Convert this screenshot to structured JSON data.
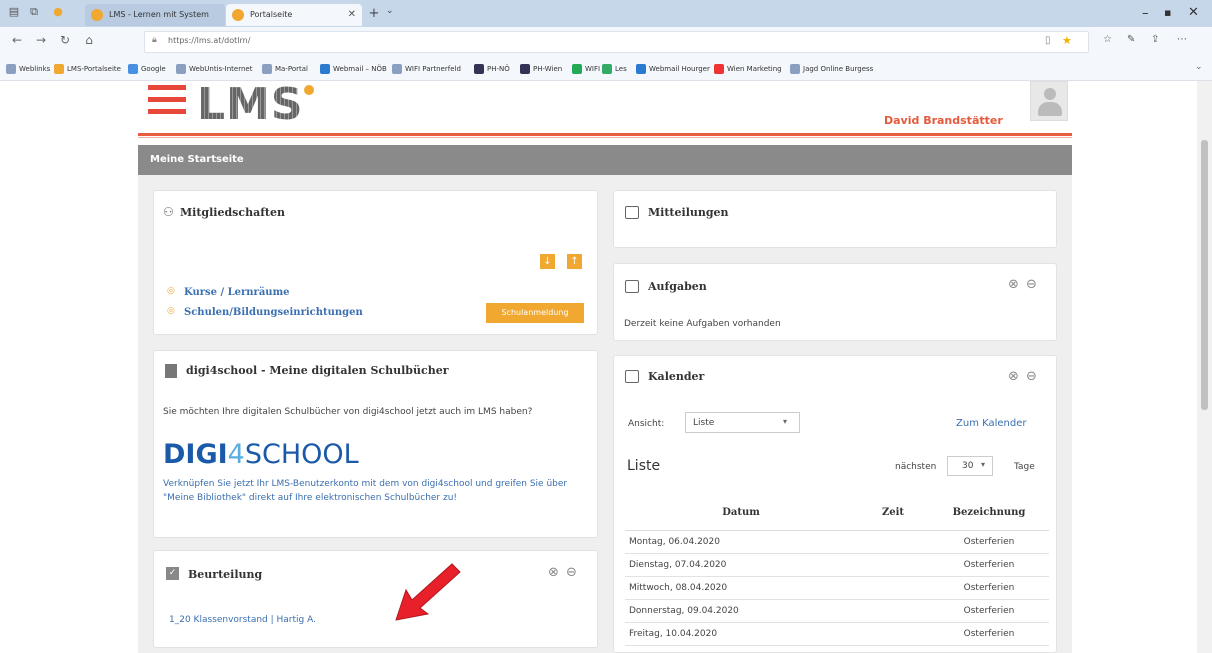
{
  "browser": {
    "tabs": [
      {
        "label": "LMS - Lernen mit System",
        "active": false
      },
      {
        "label": "Portalseite",
        "active": true
      }
    ],
    "url": "https://lms.at/dotlrn/",
    "bookmarks": [
      "Weblinks",
      "LMS-Portalseite",
      "Google",
      "WebUntis-Internet",
      "Ma-Portal",
      "Webmail – NÖB",
      "WIFI Partnerfeld",
      "PH-NÖ",
      "PH-Wien",
      "WIFI",
      "Les",
      "Webmail Hourger",
      "Wien Marketing",
      "Jagd Online Burgess"
    ]
  },
  "header": {
    "logo_text": "LMS",
    "user_name": "David Brandstätter"
  },
  "page": {
    "title": "Meine Startseite"
  },
  "mitglied": {
    "title": "Mitgliedschaften",
    "items": [
      "Kurse / Lernräume",
      "Schulen/Bildungseinrichtungen"
    ],
    "badge": "Schulanmeldung"
  },
  "digi": {
    "title": "digi4school - Meine digitalen Schulbücher",
    "intro": "Sie möchten Ihre digitalen Schulbücher von digi4school jetzt auch im LMS haben?",
    "logo_a": "DIGI",
    "logo_b": "4",
    "logo_c": "SCHOOL",
    "text": "Verknüpfen Sie jetzt Ihr LMS-Benutzerkonto mit dem von digi4school und greifen Sie über \"Meine Bibliothek\" direkt auf Ihre elektronischen Schulbücher zu!"
  },
  "beurteilung": {
    "title": "Beurteilung",
    "link": "1_20 Klassenvorstand | Hartig A."
  },
  "mitteilungen": {
    "title": "Mitteilungen"
  },
  "aufgaben": {
    "title": "Aufgaben",
    "empty": "Derzeit keine Aufgaben vorhanden"
  },
  "kalender": {
    "title": "Kalender",
    "view_label": "Ansicht:",
    "view_value": "Liste",
    "to_calendar": "Zum Kalender",
    "list_heading": "Liste",
    "next_label": "nächsten",
    "next_value": "30",
    "days_label": "Tage",
    "columns": [
      "Datum",
      "Zeit",
      "Bezeichnung"
    ],
    "rows": [
      [
        "Montag, 06.04.2020",
        "",
        "Osterferien"
      ],
      [
        "Dienstag, 07.04.2020",
        "",
        "Osterferien"
      ],
      [
        "Mittwoch, 08.04.2020",
        "",
        "Osterferien"
      ],
      [
        "Donnerstag, 09.04.2020",
        "",
        "Osterferien"
      ],
      [
        "Freitag, 10.04.2020",
        "",
        "Osterferien"
      ]
    ]
  },
  "colors": {
    "accent": "#e85d40",
    "orange": "#f0a830",
    "link": "#3a6fb0",
    "arrow": "#e8202a"
  }
}
